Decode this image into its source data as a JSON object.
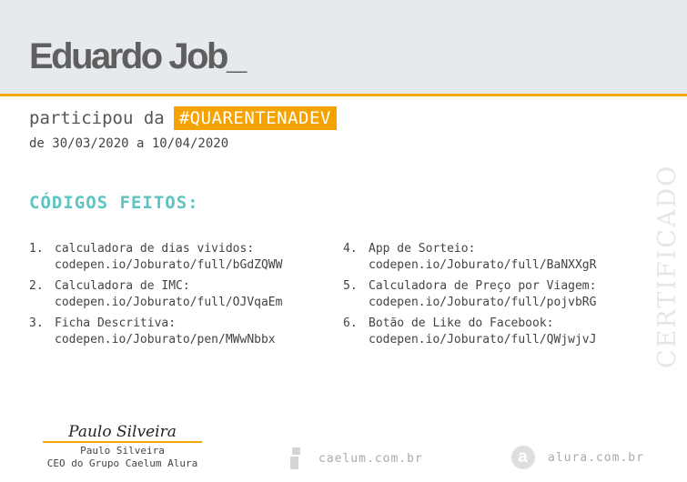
{
  "header": {
    "name": "Eduardo Job_"
  },
  "event": {
    "participated_text": "participou da",
    "hashtag": "#QUARENTENADEV",
    "dates": "de 30/03/2020 a 10/04/2020"
  },
  "codes": {
    "title": "CÓDIGOS FEITOS:",
    "items": [
      {
        "num": "1.",
        "name": "calculadora de dias vividos:",
        "url": "codepen.io/Joburato/full/bGdZQWW"
      },
      {
        "num": "4.",
        "name": "App de Sorteio:",
        "url": "codepen.io/Joburato/full/BaNXXgR"
      },
      {
        "num": "2.",
        "name": "Calculadora de IMC:",
        "url": "codepen.io/Joburato/full/OJVqaEm"
      },
      {
        "num": "5.",
        "name": "Calculadora de Preço por Viagem:",
        "url": "codepen.io/Joburato/full/pojvbRG"
      },
      {
        "num": "3.",
        "name": "Ficha Descritiva:",
        "url": "codepen.io/Joburato/pen/MWwNbbx"
      },
      {
        "num": "6.",
        "name": "Botão de Like do Facebook:",
        "url": "codepen.io/Joburato/full/QWjwjvJ"
      }
    ]
  },
  "watermark": "CERTIFICADO",
  "signature": {
    "script": "Paulo Silveira",
    "name": "Paulo Silveira",
    "role": "CEO do Grupo Caelum Alura"
  },
  "footer": {
    "caelum_url": "caelum.com.br",
    "alura_logo_letter": "a",
    "alura_url": "alura.com.br"
  }
}
